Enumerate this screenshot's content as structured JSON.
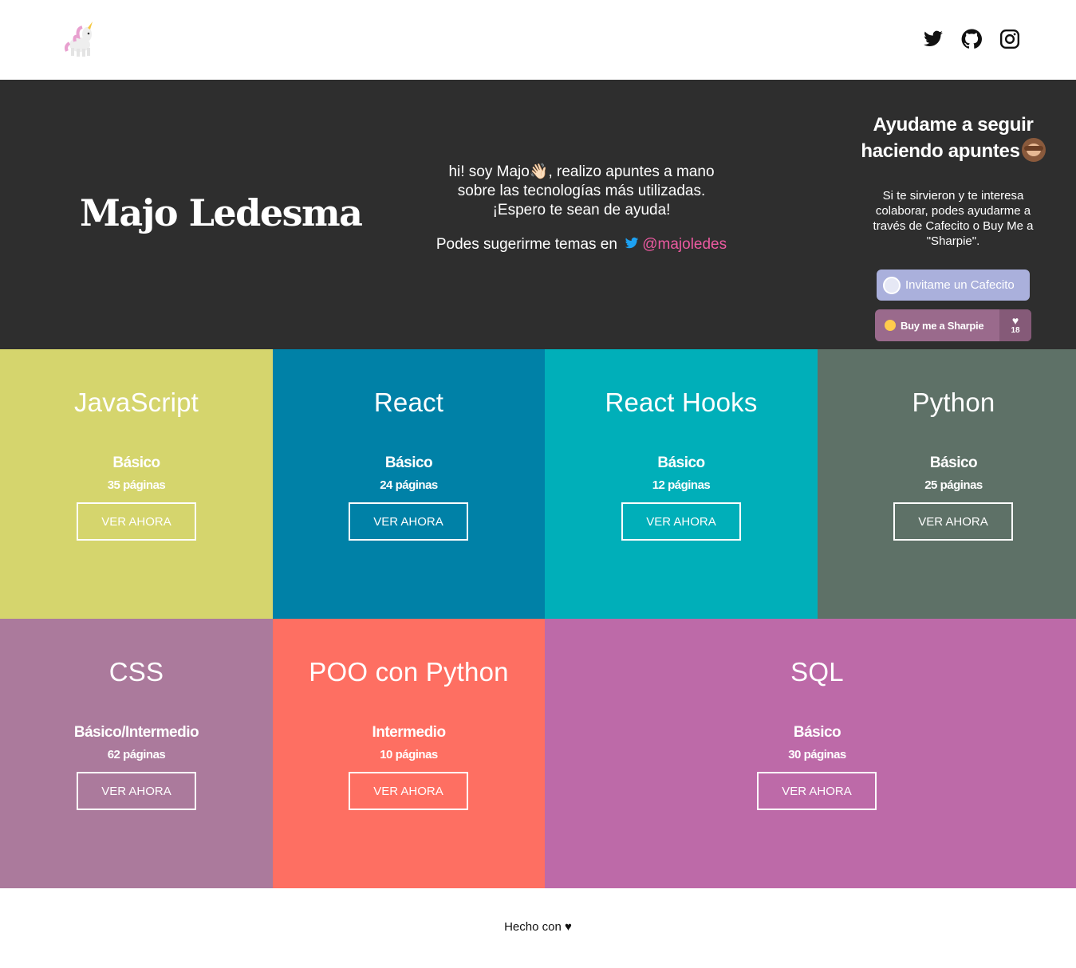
{
  "header": {
    "logo_icon": "unicorn-icon",
    "social": [
      {
        "name": "twitter-icon"
      },
      {
        "name": "github-icon"
      },
      {
        "name": "instagram-icon"
      }
    ]
  },
  "hero": {
    "name": "Majo Ledesma",
    "intro_lines": [
      "hi! soy Majo👋🏻, realizo apuntes a mano",
      "sobre las tecnologías más utilizadas.",
      "¡Espero te sean de ayuda!"
    ],
    "suggest_prefix": "Podes sugerirme temas en",
    "suggest_handle": "@majoledes",
    "support": {
      "title_line1": "Ayudame a seguir",
      "title_line2": "haciendo apuntes",
      "text": "Si te sirvieron y te interesa colaborar, podes ayudarme a través de Cafecito o Buy Me a \"Sharpie\".",
      "cafecito_label": "Invitame un Cafecito",
      "sharpie_label": "Buy me a Sharpie",
      "sharpie_count": "18"
    }
  },
  "tiles": [
    {
      "title": "JavaScript",
      "level": "Básico",
      "pages": "35 páginas",
      "button": "VER AHORA",
      "color": "#d5d56d"
    },
    {
      "title": "React",
      "level": "Básico",
      "pages": "24 páginas",
      "button": "VER AHORA",
      "color": "#0081a7"
    },
    {
      "title": "React Hooks",
      "level": "Básico",
      "pages": "12 páginas",
      "button": "VER AHORA",
      "color": "#00afb9"
    },
    {
      "title": "Python",
      "level": "Básico",
      "pages": "25 páginas",
      "button": "VER AHORA",
      "color": "#5e7167"
    },
    {
      "title": "CSS",
      "level": "Básico/Intermedio",
      "pages": "62 páginas",
      "button": "VER AHORA",
      "color": "#ab7a9c"
    },
    {
      "title": "POO con Python",
      "level": "Intermedio",
      "pages": "10 páginas",
      "button": "VER AHORA",
      "color": "#fe6f62"
    },
    {
      "title": "SQL",
      "level": "Básico",
      "pages": "30 páginas",
      "button": "VER AHORA",
      "color": "#bd6aa8"
    }
  ],
  "footer": {
    "text": "Hecho con ♥"
  },
  "colors": {
    "hero_bg": "#2e2e2e",
    "handle": "#ec5aa0",
    "cafecito_bg": "#aab0dc",
    "sharpie_bg": "#9a6a8c"
  }
}
